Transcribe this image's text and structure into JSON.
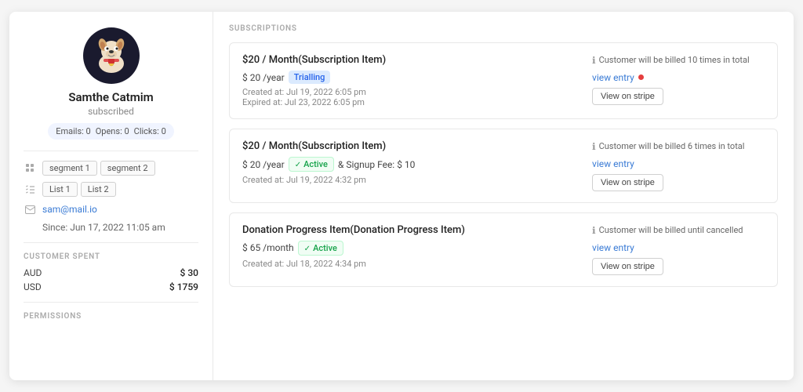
{
  "profile": {
    "name": "Samthe Catmim",
    "status": "subscribed",
    "stats": {
      "emails_label": "Emails:",
      "emails_value": "0",
      "opens_label": "Opens:",
      "opens_value": "0",
      "clicks_label": "Clicks:",
      "clicks_value": "0"
    }
  },
  "segments": [
    "segment 1",
    "segment 2"
  ],
  "lists": [
    "List 1",
    "List 2"
  ],
  "email": "sam@mail.io",
  "since": "Since: Jun 17, 2022 11:05 am",
  "customer_spent": {
    "label": "CUSTOMER SPENT",
    "rows": [
      {
        "currency": "AUD",
        "amount": "$ 30"
      },
      {
        "currency": "USD",
        "amount": "$ 1759"
      }
    ]
  },
  "permissions_label": "PERMISSIONS",
  "subscriptions_label": "SUBSCRIPTIONS",
  "subscriptions": [
    {
      "title": "$20 / Month(Subscription Item)",
      "price": "$ 20 /year",
      "badge_type": "trialling",
      "badge_label": "Trialling",
      "created": "Created at: Jul 19, 2022 6:05 pm",
      "expired": "Expired at: Jul 23, 2022 6:05 pm",
      "note": "Customer will be billed 10 times in total",
      "view_entry_label": "view entry",
      "stripe_button": "View on stripe",
      "has_dot": true
    },
    {
      "title": "$20 / Month(Subscription Item)",
      "price": "$ 20 /year",
      "badge_type": "active",
      "badge_label": "Active",
      "signup_fee": "& Signup Fee: $ 10",
      "created": "Created at: Jul 19, 2022 4:32 pm",
      "note": "Customer will be billed 6 times in total",
      "view_entry_label": "view entry",
      "stripe_button": "View on stripe",
      "has_dot": false
    },
    {
      "title": "Donation Progress Item(Donation Progress Item)",
      "price": "$ 65 /month",
      "badge_type": "active",
      "badge_label": "Active",
      "created": "Created at: Jul 18, 2022 4:34 pm",
      "note": "Customer will be billed until cancelled",
      "view_entry_label": "view entry",
      "stripe_button": "View on stripe",
      "has_dot": false
    }
  ]
}
